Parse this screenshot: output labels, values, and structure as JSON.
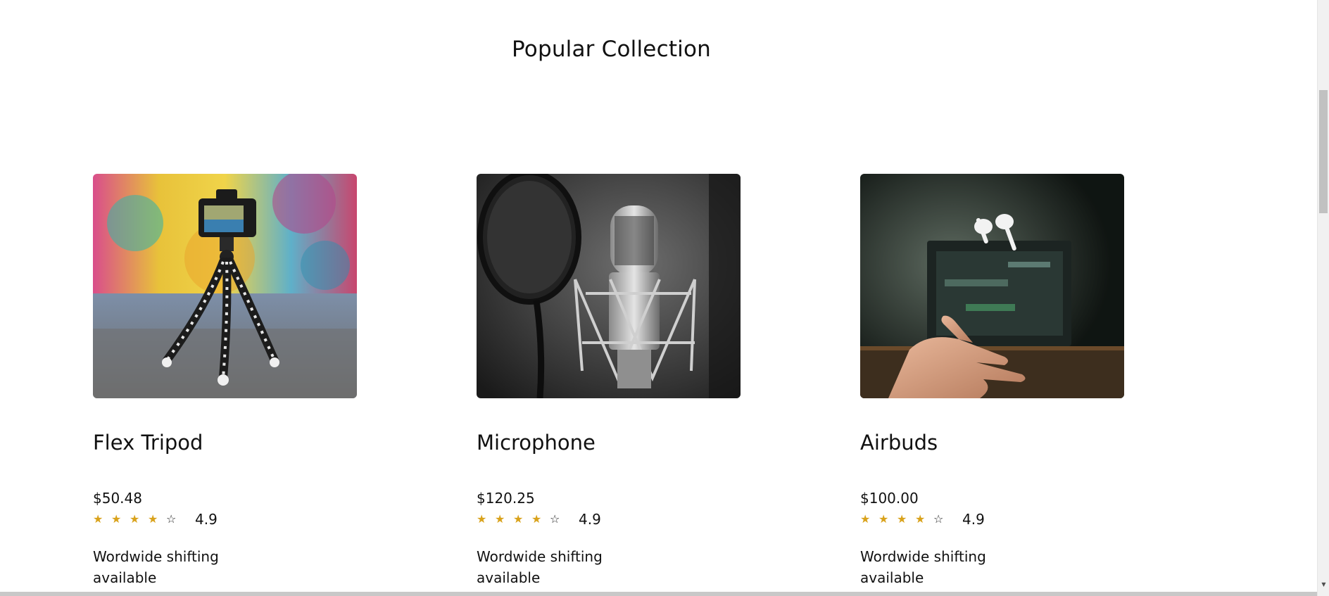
{
  "section": {
    "title": "Popular Collection"
  },
  "products": [
    {
      "name": "Flex Tripod",
      "price": "$50.48",
      "rating": "4.9",
      "stars_filled": 4,
      "stars_total": 5,
      "shipping": "Wordwide shifting available",
      "image_icon": "tripod-camera-photo"
    },
    {
      "name": "Microphone",
      "price": "$120.25",
      "rating": "4.9",
      "stars_filled": 4,
      "stars_total": 5,
      "shipping": "Wordwide shifting available",
      "image_icon": "studio-microphone-photo"
    },
    {
      "name": "Airbuds",
      "price": "$100.00",
      "rating": "4.9",
      "stars_filled": 4,
      "stars_total": 5,
      "shipping": "Wordwide shifting available",
      "image_icon": "airbuds-hand-photo"
    }
  ],
  "colors": {
    "star_filled": "#d9a21b",
    "text": "#111111",
    "background": "#ffffff"
  }
}
